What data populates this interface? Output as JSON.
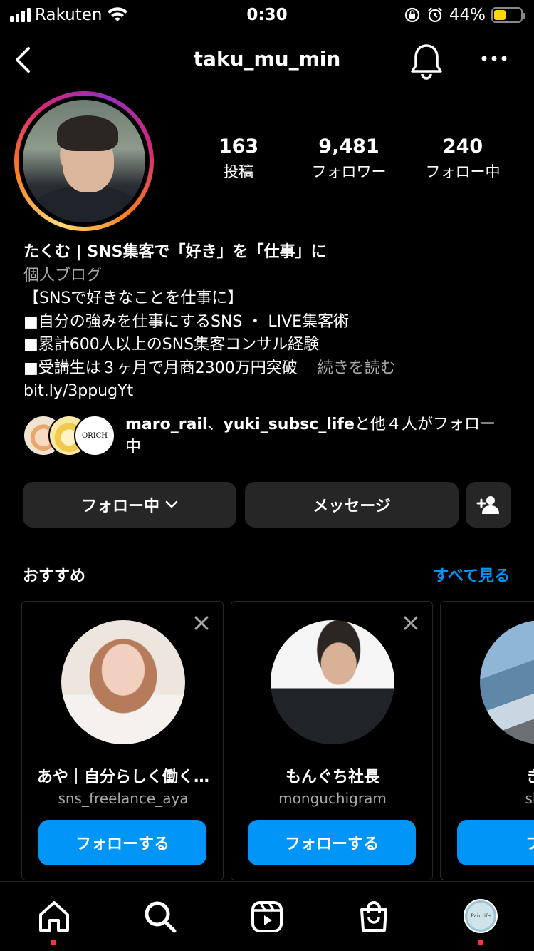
{
  "status_bar": {
    "carrier": "Rakuten",
    "time": "0:30",
    "battery_percent": "44%",
    "battery_level": 0.44,
    "battery_color": "#ffd60a"
  },
  "header": {
    "username": "taku_mu_min",
    "back_icon": "chevron-left-icon",
    "bell_icon": "bell-icon",
    "more_icon": "more-horizontal-icon"
  },
  "stats": [
    {
      "value": "163",
      "label": "投稿"
    },
    {
      "value": "9,481",
      "label": "フォロワー"
    },
    {
      "value": "240",
      "label": "フォロー中"
    }
  ],
  "bio": {
    "name": "たくむ | SNS集客で「好き」を「仕事」に",
    "category": "個人ブログ",
    "lines": [
      "【SNSで好きなことを仕事に】",
      "■自分の強みを仕事にするSNS ・ LIVE集客術",
      "■累計600人以上のSNS集客コンサル経験",
      "■受講生は３ヶ月で月商2300万円突破"
    ],
    "more_label": "続きを読む",
    "link": "bit.ly/3ppugYt"
  },
  "followed_by": {
    "user1": "maro_rail",
    "separator": "、",
    "user2": "yuki_subsc_life",
    "suffix": "と他４人",
    "tail": "がフォロー中",
    "mini_label": "ORICH"
  },
  "actions": {
    "following_label": "フォロー中",
    "message_label": "メッセージ",
    "add_person_icon": "add-person-icon"
  },
  "suggested": {
    "title": "おすすめ",
    "see_all": "すべて見る",
    "cards": [
      {
        "name": "あや｜自分らしく働く…",
        "handle": "sns_freelance_aya",
        "button": "フォローする"
      },
      {
        "name": "もんぐち社長",
        "handle": "monguchigram",
        "button": "フォローする"
      },
      {
        "name": "きた",
        "handle": "shuji",
        "button": "フォ"
      }
    ]
  },
  "tabbar": {
    "home_icon": "home-icon",
    "search_icon": "search-icon",
    "reels_icon": "reels-icon",
    "shop_icon": "shop-icon",
    "profile_label": "Pair life"
  },
  "colors": {
    "accent": "#0095f6",
    "button_bg": "#262626",
    "notification_dot": "#ff3040"
  }
}
